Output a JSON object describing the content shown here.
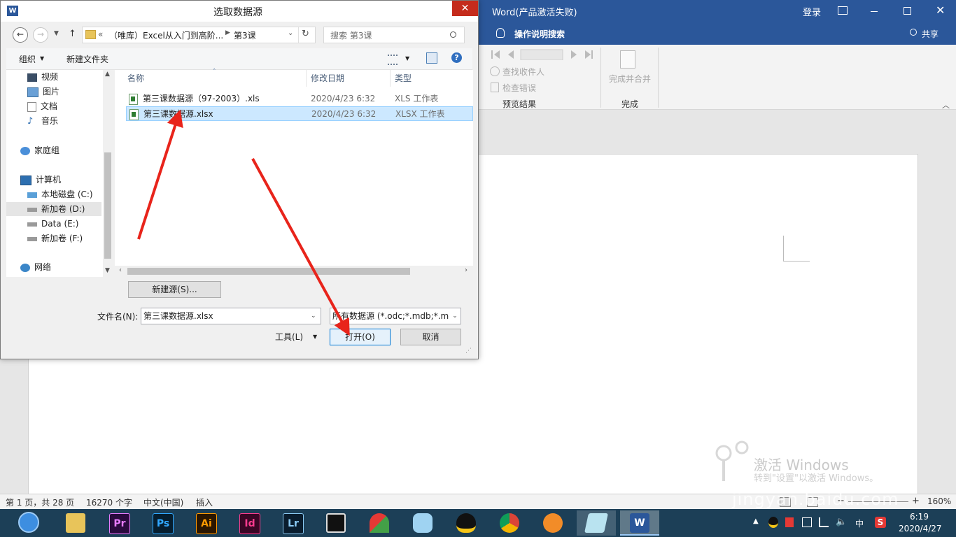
{
  "word": {
    "title": "Word(产品激活失败)",
    "login": "登录",
    "tell_me": "操作说明搜索",
    "share": "共享",
    "ribbon": {
      "find_recipient": "查找收件人",
      "check_errors": "检查错误",
      "preview_group": "预览结果",
      "finish_merge": "完成并合并",
      "finish_group": "完成"
    },
    "status": {
      "page": "第 1 页，共 28 页",
      "words": "16270 个字",
      "language": "中文(中国)",
      "mode": "插入",
      "zoom": "160%"
    },
    "watermark": {
      "activate": "激活 Windows",
      "activate_sub": "转到\"设置\"以激活 Windows。",
      "site": "jingyan.baidu.com"
    }
  },
  "dialog": {
    "title": "选取数据源",
    "breadcrumb": [
      "«",
      "（唯库）Excel从入门到高阶...",
      "第3课"
    ],
    "search_placeholder": "搜索 第3课",
    "organize": "组织",
    "new_folder": "新建文件夹",
    "nav_items": [
      {
        "label": "视频",
        "icon": "video-icon"
      },
      {
        "label": "图片",
        "icon": "picture-icon"
      },
      {
        "label": "文档",
        "icon": "document-icon"
      },
      {
        "label": "音乐",
        "icon": "music-icon"
      },
      {
        "label": "家庭组",
        "icon": "homegroup-icon"
      },
      {
        "label": "计算机",
        "icon": "computer-icon"
      },
      {
        "label": "本地磁盘 (C:)",
        "icon": "drive-icon"
      },
      {
        "label": "新加卷 (D:)",
        "icon": "drive-icon"
      },
      {
        "label": "Data (E:)",
        "icon": "drive-icon"
      },
      {
        "label": "新加卷 (F:)",
        "icon": "drive-icon"
      },
      {
        "label": "网络",
        "icon": "network-icon"
      }
    ],
    "columns": {
      "name": "名称",
      "date": "修改日期",
      "type": "类型"
    },
    "files": [
      {
        "name": "第三课数据源（97-2003）.xls",
        "date": "2020/4/23 6:32",
        "type": "XLS 工作表"
      },
      {
        "name": "第三课数据源.xlsx",
        "date": "2020/4/23 6:32",
        "type": "XLSX 工作表"
      }
    ],
    "new_source": "新建源(S)...",
    "filename_label": "文件名(N):",
    "filename_value": "第三课数据源.xlsx",
    "filetype_value": "所有数据源 (*.odc;*.mdb;*.md",
    "tools": "工具(L)",
    "open": "打开(O)",
    "cancel": "取消"
  },
  "taskbar": {
    "apps": [
      {
        "name": "Pr",
        "color": "#2a0a3e",
        "fg": "#e77cff"
      },
      {
        "name": "Ps",
        "color": "#061e2f",
        "fg": "#31a8ff"
      },
      {
        "name": "Ai",
        "color": "#2b1600",
        "fg": "#ff9a00"
      },
      {
        "name": "Id",
        "color": "#3a0625",
        "fg": "#ff3b8f"
      },
      {
        "name": "Lr",
        "color": "#0a1d2e",
        "fg": "#8ac9f3"
      }
    ],
    "time": "6:19",
    "date": "2020/4/27",
    "ime": "中"
  }
}
